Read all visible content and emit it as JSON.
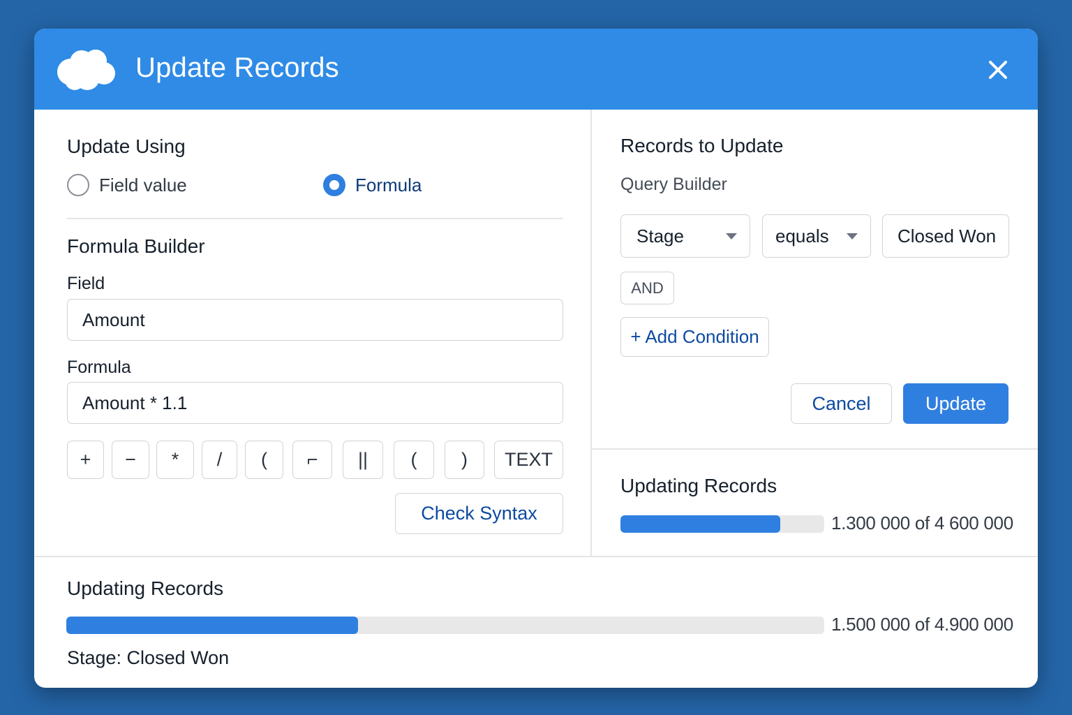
{
  "dialog": {
    "title": "Update Records"
  },
  "update_using": {
    "heading": "Update Using",
    "options": [
      {
        "label": "Field value",
        "selected": false
      },
      {
        "label": "Formula",
        "selected": true
      }
    ]
  },
  "formula_builder": {
    "heading": "Formula Builder",
    "field_label": "Field",
    "field_value": "Amount",
    "formula_label": "Formula",
    "formula_value": "Amount * 1.1",
    "operators": [
      "+",
      "−",
      "*",
      "/",
      "(",
      "⌐",
      "||",
      "(",
      ")",
      "TEXT"
    ],
    "check_syntax_label": "Check Syntax"
  },
  "records_to_update": {
    "heading": "Records to Update",
    "subheading": "Query Builder",
    "condition": {
      "field": "Stage",
      "operator": "equals",
      "value": "Closed Won"
    },
    "logic_badge": "AND",
    "add_condition_label": "+ Add Condition",
    "cancel_label": "Cancel",
    "update_label": "Update"
  },
  "progress_right": {
    "heading": "Updating Records",
    "fraction": 0.783,
    "text": "1.300 000 of 4 600 000"
  },
  "progress_bottom": {
    "heading": "Updating Records",
    "fraction": 0.385,
    "text": "1.500 000 of 4.900 000",
    "filter_text": "Stage: Closed Won"
  },
  "colors": {
    "header": "#2f8be6",
    "accent": "#2f7fe0",
    "background": "#2465a8"
  },
  "icons": {
    "logo": "cloud-logo",
    "close": "close-icon"
  }
}
